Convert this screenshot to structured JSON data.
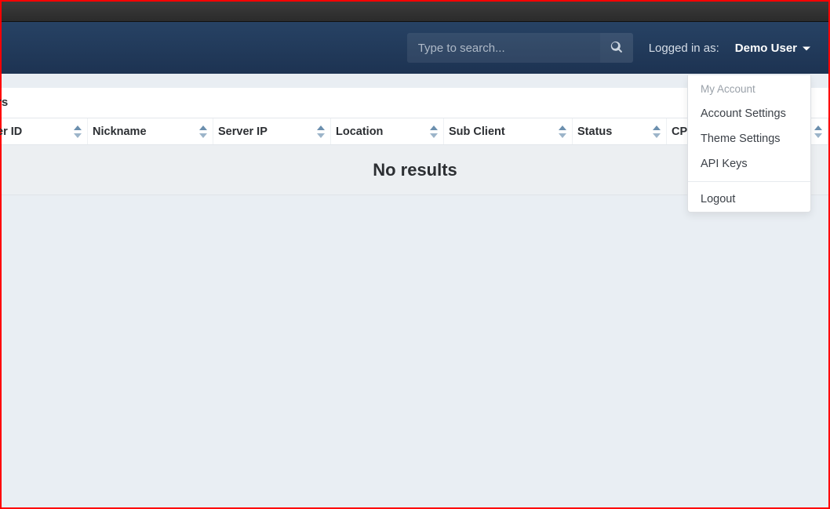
{
  "header": {
    "search_placeholder": "Type to search...",
    "logged_in_label": "Logged in as:",
    "user_name": "Demo User"
  },
  "user_menu": {
    "section_label": "My Account",
    "items": [
      {
        "label": "Account Settings"
      },
      {
        "label": "Theme Settings"
      },
      {
        "label": "API Keys"
      }
    ],
    "logout_label": "Logout"
  },
  "panel": {
    "title_fragment": "rs"
  },
  "table": {
    "columns": [
      {
        "label": "er ID"
      },
      {
        "label": "Nickname"
      },
      {
        "label": "Server IP"
      },
      {
        "label": "Location"
      },
      {
        "label": "Sub Client"
      },
      {
        "label": "Status"
      },
      {
        "label": "CPU"
      }
    ],
    "empty_message": "No results"
  }
}
